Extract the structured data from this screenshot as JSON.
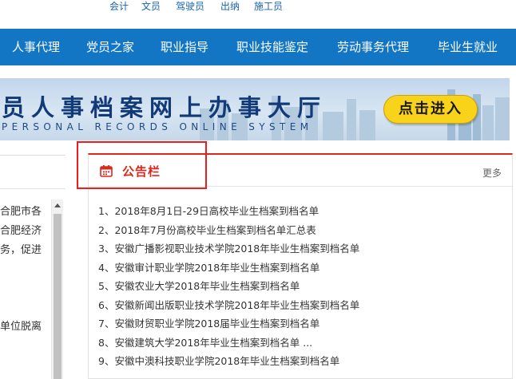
{
  "top_links": [
    "会计",
    "文员",
    "驾驶员",
    "出纳",
    "施工员"
  ],
  "nav": [
    "人事代理",
    "党员之家",
    "职业指导",
    "职业技能鉴定",
    "劳动事务代理",
    "毕业生就业"
  ],
  "banner": {
    "title": "员人事档案网上办事大厅",
    "subtitle": "PERSONAL RECORDS ONLINE SYSTEM",
    "enter_label": "点击进入"
  },
  "left_panel": {
    "lines": [
      "合肥市各",
      "合肥经济",
      "务，促进",
      "单位脱离"
    ]
  },
  "notice": {
    "icon": "calendar-icon",
    "title": "公告栏",
    "more": "更多",
    "items": [
      "1、2018年8月1日-29日高校毕业生档案到档名单",
      "2、2018年7月份高校毕业生档案到档名单汇总表",
      "3、安徽广播影视职业技术学院2018年毕业生档案到档名单",
      "4、安徽审计职业学院2018年毕业生档案到档名单",
      "5、安徽农业大学2018年毕业生档案到档名单",
      "6、安徽新闻出版职业技术学院2018年毕业生档案到档名单",
      "7、安徽财贸职业学院2018届毕业生档案到档名单",
      "8、安徽建筑大学2018年毕业生档案到档名单 ...",
      "9、安徽中澳科技职业学院2018年毕业生档案到档名单"
    ]
  },
  "colors": {
    "nav_bg": "#1276c5",
    "accent_red": "#d9281d",
    "link_blue": "#1a64b0",
    "button_yellow": "#f8d319"
  }
}
